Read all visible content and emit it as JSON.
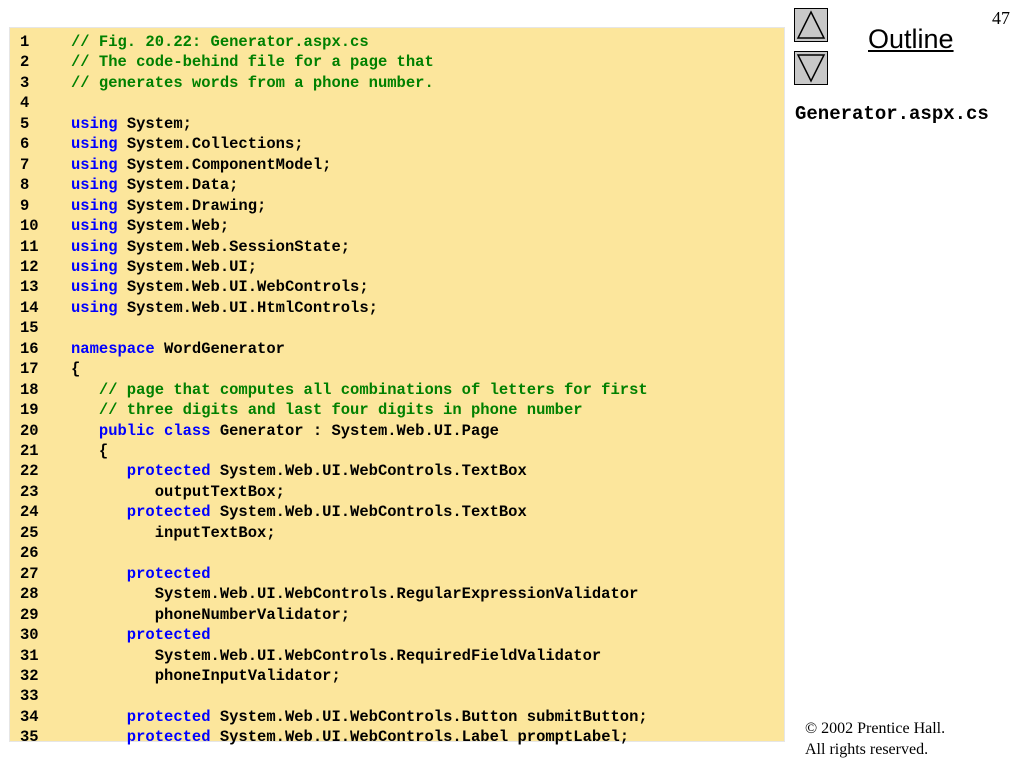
{
  "slide": {
    "page_number": "47",
    "outline_label": "Outline",
    "file_name": "Generator.aspx.cs",
    "copyright_line1": "© 2002 Prentice Hall.",
    "copyright_line2": "All rights reserved.",
    "colors": {
      "code_background": "#fce69c",
      "comment": "#008000",
      "keyword": "#0000ff",
      "nav_button": "#c8c8c8"
    },
    "icons": {
      "up": "triangle-up-icon",
      "down": "triangle-down-icon"
    }
  },
  "code_lines": [
    {
      "n": "1",
      "s": [
        {
          "c": "cm",
          "t": "// Fig. 20.22: Generator.aspx.cs"
        }
      ]
    },
    {
      "n": "2",
      "s": [
        {
          "c": "cm",
          "t": "// The code-behind file for a page that"
        }
      ]
    },
    {
      "n": "3",
      "s": [
        {
          "c": "cm",
          "t": "// generates words from a phone number."
        }
      ]
    },
    {
      "n": "4",
      "s": []
    },
    {
      "n": "5",
      "s": [
        {
          "c": "kw",
          "t": "using"
        },
        {
          "c": "",
          "t": " System;"
        }
      ]
    },
    {
      "n": "6",
      "s": [
        {
          "c": "kw",
          "t": "using"
        },
        {
          "c": "",
          "t": " System.Collections;"
        }
      ]
    },
    {
      "n": "7",
      "s": [
        {
          "c": "kw",
          "t": "using"
        },
        {
          "c": "",
          "t": " System.ComponentModel;"
        }
      ]
    },
    {
      "n": "8",
      "s": [
        {
          "c": "kw",
          "t": "using"
        },
        {
          "c": "",
          "t": " System.Data;"
        }
      ]
    },
    {
      "n": "9",
      "s": [
        {
          "c": "kw",
          "t": "using"
        },
        {
          "c": "",
          "t": " System.Drawing;"
        }
      ]
    },
    {
      "n": "10",
      "s": [
        {
          "c": "kw",
          "t": "using"
        },
        {
          "c": "",
          "t": " System.Web;"
        }
      ]
    },
    {
      "n": "11",
      "s": [
        {
          "c": "kw",
          "t": "using"
        },
        {
          "c": "",
          "t": " System.Web.SessionState;"
        }
      ]
    },
    {
      "n": "12",
      "s": [
        {
          "c": "kw",
          "t": "using"
        },
        {
          "c": "",
          "t": " System.Web.UI;"
        }
      ]
    },
    {
      "n": "13",
      "s": [
        {
          "c": "kw",
          "t": "using"
        },
        {
          "c": "",
          "t": " System.Web.UI.WebControls;"
        }
      ]
    },
    {
      "n": "14",
      "s": [
        {
          "c": "kw",
          "t": "using"
        },
        {
          "c": "",
          "t": " System.Web.UI.HtmlControls;"
        }
      ]
    },
    {
      "n": "15",
      "s": []
    },
    {
      "n": "16",
      "s": [
        {
          "c": "kw",
          "t": "namespace"
        },
        {
          "c": "",
          "t": " WordGenerator"
        }
      ]
    },
    {
      "n": "17",
      "s": [
        {
          "c": "",
          "t": "{"
        }
      ]
    },
    {
      "n": "18",
      "s": [
        {
          "c": "cm",
          "t": "   // page that computes all combinations of letters for first"
        }
      ]
    },
    {
      "n": "19",
      "s": [
        {
          "c": "cm",
          "t": "   // three digits and last four digits in phone number"
        }
      ]
    },
    {
      "n": "20",
      "s": [
        {
          "c": "kw",
          "t": "   public class"
        },
        {
          "c": "",
          "t": " Generator : System.Web.UI.Page"
        }
      ]
    },
    {
      "n": "21",
      "s": [
        {
          "c": "",
          "t": "   {"
        }
      ]
    },
    {
      "n": "22",
      "s": [
        {
          "c": "kw",
          "t": "      protected"
        },
        {
          "c": "",
          "t": " System.Web.UI.WebControls.TextBox"
        }
      ]
    },
    {
      "n": "23",
      "s": [
        {
          "c": "",
          "t": "         outputTextBox;"
        }
      ]
    },
    {
      "n": "24",
      "s": [
        {
          "c": "kw",
          "t": "      protected"
        },
        {
          "c": "",
          "t": " System.Web.UI.WebControls.TextBox"
        }
      ]
    },
    {
      "n": "25",
      "s": [
        {
          "c": "",
          "t": "         inputTextBox;"
        }
      ]
    },
    {
      "n": "26",
      "s": []
    },
    {
      "n": "27",
      "s": [
        {
          "c": "kw",
          "t": "      protected"
        }
      ]
    },
    {
      "n": "28",
      "s": [
        {
          "c": "",
          "t": "         System.Web.UI.WebControls.RegularExpressionValidator"
        }
      ]
    },
    {
      "n": "29",
      "s": [
        {
          "c": "",
          "t": "         phoneNumberValidator;"
        }
      ]
    },
    {
      "n": "30",
      "s": [
        {
          "c": "kw",
          "t": "      protected"
        }
      ]
    },
    {
      "n": "31",
      "s": [
        {
          "c": "",
          "t": "         System.Web.UI.WebControls.RequiredFieldValidator"
        }
      ]
    },
    {
      "n": "32",
      "s": [
        {
          "c": "",
          "t": "         phoneInputValidator;"
        }
      ]
    },
    {
      "n": "33",
      "s": []
    },
    {
      "n": "34",
      "s": [
        {
          "c": "kw",
          "t": "      protected"
        },
        {
          "c": "",
          "t": " System.Web.UI.WebControls.Button submitButton;"
        }
      ]
    },
    {
      "n": "35",
      "s": [
        {
          "c": "kw",
          "t": "      protected"
        },
        {
          "c": "",
          "t": " System.Web.UI.WebControls.Label promptLabel;"
        }
      ]
    }
  ]
}
